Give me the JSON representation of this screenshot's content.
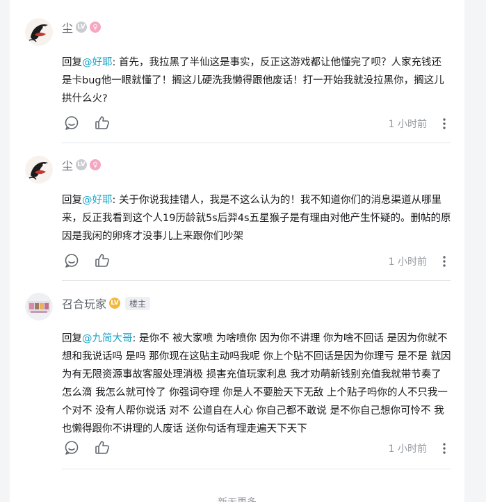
{
  "comments": [
    {
      "username": "尘",
      "level": "LV",
      "gender_symbol": "♀",
      "reply_prefix": "回复",
      "mention": "@好耶",
      "text": ": 首先，我拉黑了半仙这是事实，反正这游戏都让他懂完了呗？人家充钱还是卡bug他一眼就懂了！搁这儿硬洗我懒得跟他废话！打一开始我就没拉黑你，搁这儿拱什么火?",
      "time": "1 小时前",
      "icons": [
        "comment-icon",
        "thumbs-up-icon",
        "more-icon"
      ]
    },
    {
      "username": "尘",
      "level": "LV",
      "gender_symbol": "♀",
      "reply_prefix": "回复",
      "mention": "@好耶",
      "text": ": 关于你说我挂错人，我是不这么认为的！我不知道你们的消息渠道从哪里来，反正我看到这个人19历龄就5s后羿4s五星猴子是有理由对他产生怀疑的。删帖的原因是我闲的卵疼才没事儿上来跟你们吵架",
      "time": "1 小时前",
      "icons": [
        "comment-icon",
        "thumbs-up-icon",
        "more-icon"
      ]
    },
    {
      "username": "召合玩家",
      "level": "LV",
      "owner_badge": "楼主",
      "reply_prefix": "回复",
      "mention": "@九简大哥",
      "text": ": 是你不 被大家喷 为啥喷你 因为你不讲理 你为啥不回话 是因为你就不想和我说话吗 是吗 那你现在这贴主动吗我呢 你上个贴不回话是因为你理亏 是不是 就因为有无限资源事故客服处理消极 损害充值玩家利息 我才劝萌新钱别充值我就带节奏了 怎么滴 我怎么就可怜了 你强词夺理 你是人不要脸天下无敌 上个贴子吗你的人不只我一个对不 没有人帮你说话 对不 公道自在人心 你自己都不敢说 是不你自己想你可怜不 我也懒得跟你不讲理的人废话 送你句话有理走遍天下天下",
      "time": "1 小时前",
      "icons": [
        "comment-icon",
        "thumbs-up-icon",
        "more-icon"
      ]
    }
  ],
  "load_more": "新无更多"
}
